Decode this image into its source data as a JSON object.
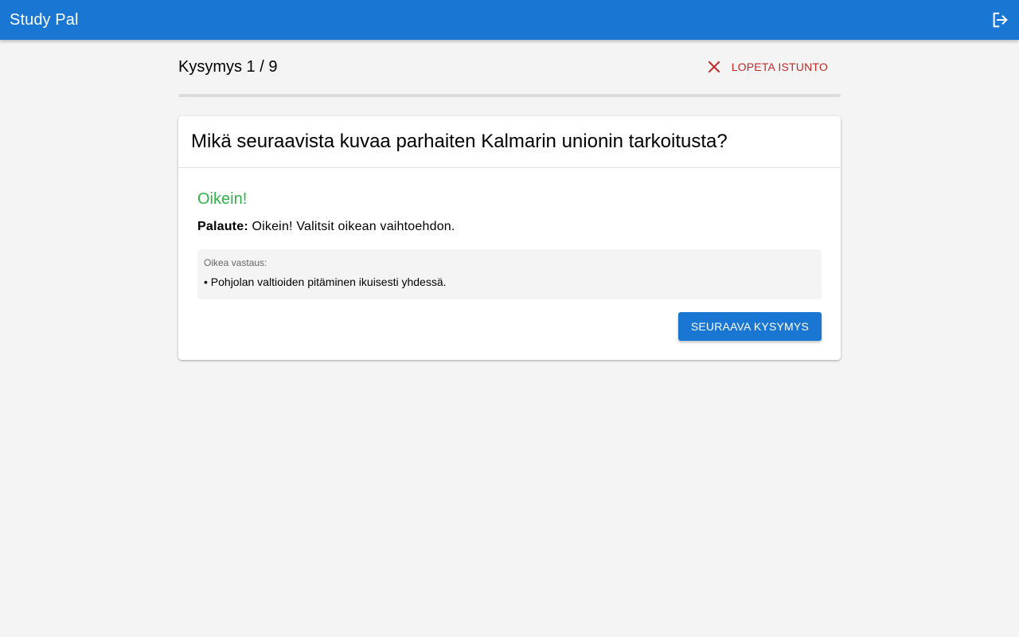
{
  "app": {
    "title": "Study Pal",
    "logout_icon": "logout-icon"
  },
  "session": {
    "counter": "Kysymys 1 / 9",
    "end_label": "Lopeta istunto",
    "end_icon": "close-icon",
    "progress": 0.0
  },
  "question": {
    "text": "Mikä seuraavista kuvaa parhaiten Kalmarin unionin tarkoitusta?"
  },
  "result": {
    "title": "Oikein!",
    "feedback_label": "Palaute:",
    "feedback_text": " Oikein! Valitsit oikean vaihtoehdon.",
    "correct_answer_label": "Oikea vastaus:",
    "correct_answers": [
      "• Pohjolan valtioiden pitäminen ikuisesti yhdessä."
    ]
  },
  "actions": {
    "next_label": "Seuraava kysymys"
  },
  "colors": {
    "primary": "#1976d2",
    "danger": "#c62828",
    "success": "#2fb34a",
    "background": "#f4f4f4"
  }
}
